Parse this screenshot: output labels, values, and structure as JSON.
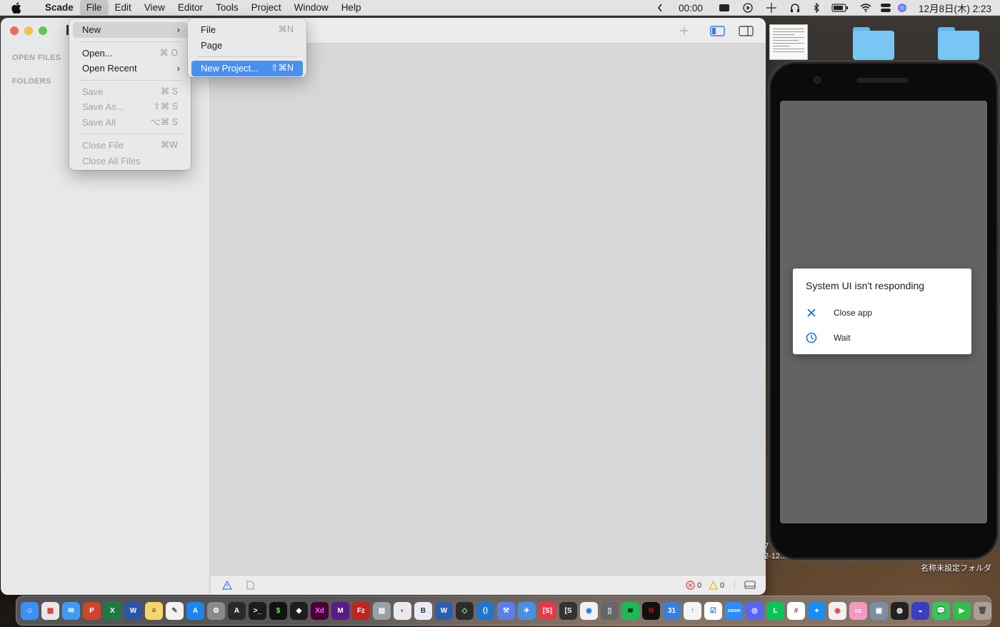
{
  "menubar": {
    "app_name": "Scade",
    "menus": [
      "File",
      "Edit",
      "View",
      "Editor",
      "Tools",
      "Project",
      "Window",
      "Help"
    ],
    "status": {
      "timer": "00:00",
      "datetime": "12月8日(木) 2:23"
    }
  },
  "sidebar": {
    "open_files_label": "OPEN FILES",
    "folders_label": "FOLDERS"
  },
  "statusbar": {
    "errors": "0",
    "warnings": "0"
  },
  "file_menu": {
    "items": [
      {
        "label": "New",
        "shortcut": "",
        "state": "selected",
        "submenu": true
      },
      {
        "label": "Open...",
        "shortcut": "⌘ O",
        "state": "enabled"
      },
      {
        "label": "Open Recent",
        "shortcut": "",
        "state": "enabled",
        "submenu": true
      },
      {
        "label": "Save",
        "shortcut": "⌘ S",
        "state": "disabled"
      },
      {
        "label": "Save As...",
        "shortcut": "⇧⌘ S",
        "state": "disabled"
      },
      {
        "label": "Save All",
        "shortcut": "⌥⌘ S",
        "state": "disabled"
      },
      {
        "label": "Close File",
        "shortcut": "⌘W",
        "state": "disabled"
      },
      {
        "label": "Close All Files",
        "shortcut": "",
        "state": "disabled"
      }
    ]
  },
  "new_submenu": {
    "items": [
      {
        "label": "File",
        "shortcut": "⌘N"
      },
      {
        "label": "Page",
        "shortcut": ""
      },
      {
        "label": "New Project...",
        "shortcut": "⇧⌘N"
      }
    ]
  },
  "phone_dialog": {
    "title": "System UI isn't responding",
    "options": [
      {
        "label": "Close app",
        "icon": "close-icon"
      },
      {
        "label": "Wait",
        "icon": "clock-icon"
      }
    ]
  },
  "desktop": {
    "folder_caption": "名称未設定フォルダ",
    "side_caption_1": "7",
    "side_caption_2": "2-12..."
  },
  "colors": {
    "menu_highlight": "#4a8ff0",
    "dialog_accent": "#1a73e8"
  }
}
